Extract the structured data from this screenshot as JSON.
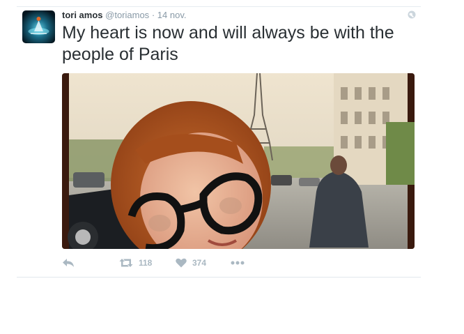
{
  "tweet": {
    "author_name": "tori amos",
    "handle": "@toriamos",
    "separator": "·",
    "timestamp": "14 nov.",
    "text": "My heart is now and will always be with the people of Paris"
  },
  "actions": {
    "reply_icon": "reply-icon",
    "retweet_icon": "retweet-icon",
    "retweet_count": "118",
    "like_icon": "heart-icon",
    "like_count": "374",
    "more_icon": "more-icon"
  },
  "header_icon": "globe-icon",
  "colors": {
    "text": "#292f33",
    "muted": "#8899a6",
    "action": "#aab8c2",
    "divider": "#e1e8ed"
  }
}
